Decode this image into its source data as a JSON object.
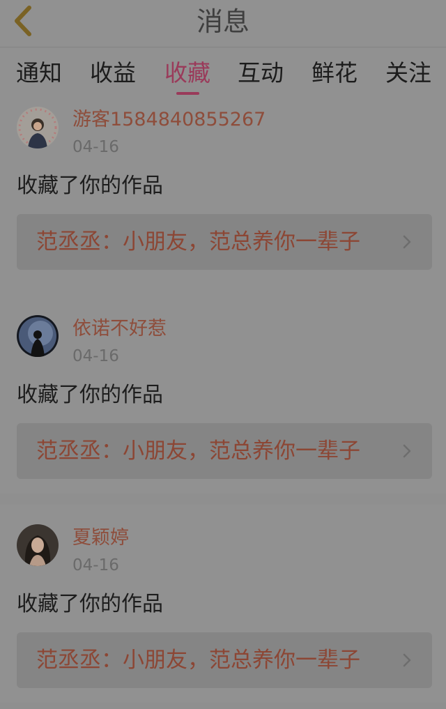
{
  "header": {
    "title": "消息",
    "back_icon": "chevron-left-icon"
  },
  "tabs": [
    {
      "label": "通知",
      "active": false
    },
    {
      "label": "收益",
      "active": false
    },
    {
      "label": "收藏",
      "active": true
    },
    {
      "label": "互动",
      "active": false
    },
    {
      "label": "鲜花",
      "active": false
    },
    {
      "label": "关注",
      "active": false
    }
  ],
  "colors": {
    "accent": "#9a3a5a",
    "username": "#8e4d3b",
    "work_link": "#8c4634"
  },
  "messages": [
    {
      "username": "游客1584840855267",
      "date": "04-16",
      "action": "收藏了你的作品",
      "work": "范丞丞：小朋友，范总养你一辈子"
    },
    {
      "username": "依诺不好惹",
      "date": "04-16",
      "action": "收藏了你的作品",
      "work": "范丞丞：小朋友，范总养你一辈子"
    },
    {
      "username": "夏颖婷",
      "date": "04-16",
      "action": "收藏了你的作品",
      "work": "范丞丞：小朋友，范总养你一辈子"
    }
  ]
}
